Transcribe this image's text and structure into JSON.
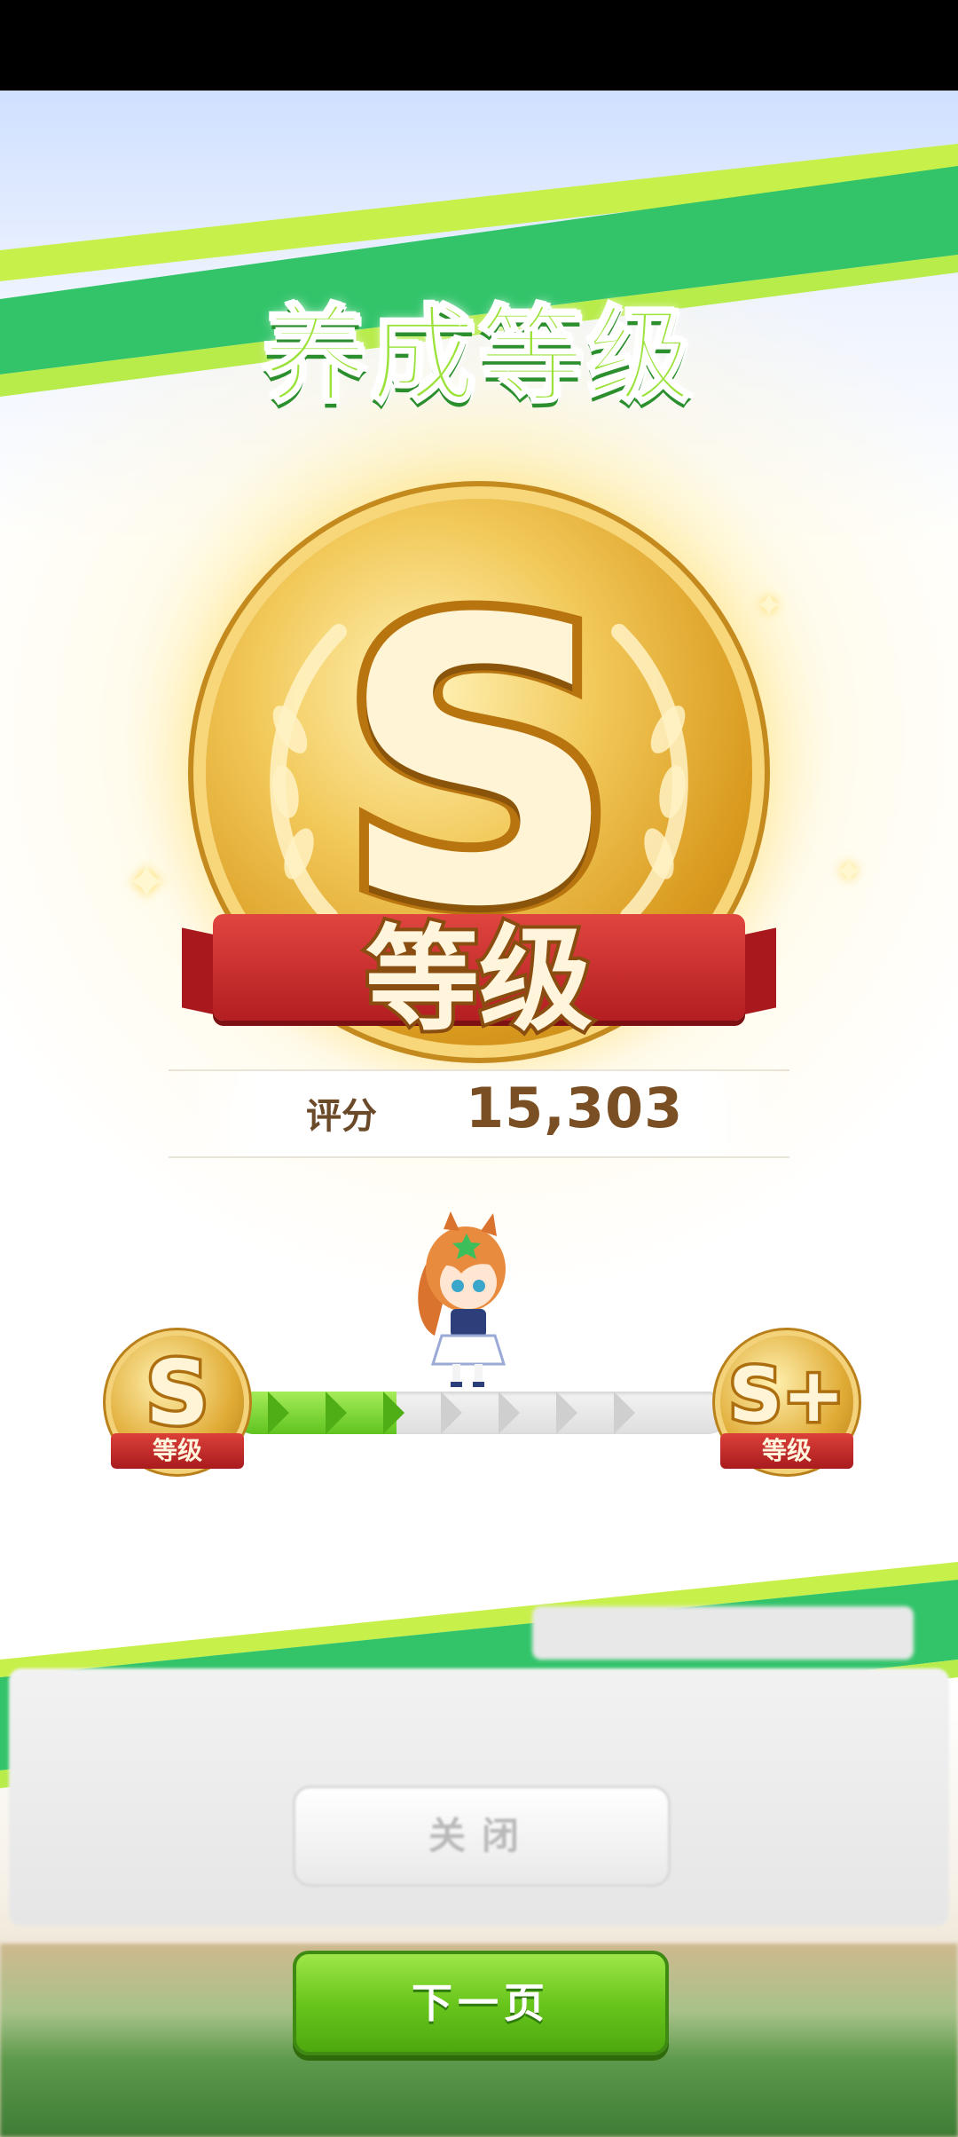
{
  "screen": {
    "title": "养成等级",
    "rank": {
      "letter": "S",
      "ribbon_label": "等级"
    },
    "score": {
      "label": "评分",
      "value": "15,303"
    },
    "progress": {
      "fraction": 0.33,
      "from_rank": {
        "letter": "S",
        "label": "等级"
      },
      "to_rank": {
        "letter": "S+",
        "label": "等级"
      }
    },
    "background_dialog": {
      "close_label": "关闭"
    },
    "buttons": {
      "next_label": "下一页"
    }
  },
  "colors": {
    "accent_green": "#69c61c",
    "stripe_green": "#33c46a",
    "ribbon_red": "#c82a2a",
    "medal_gold": "#e0ab35",
    "score_text": "#7a4f23"
  }
}
